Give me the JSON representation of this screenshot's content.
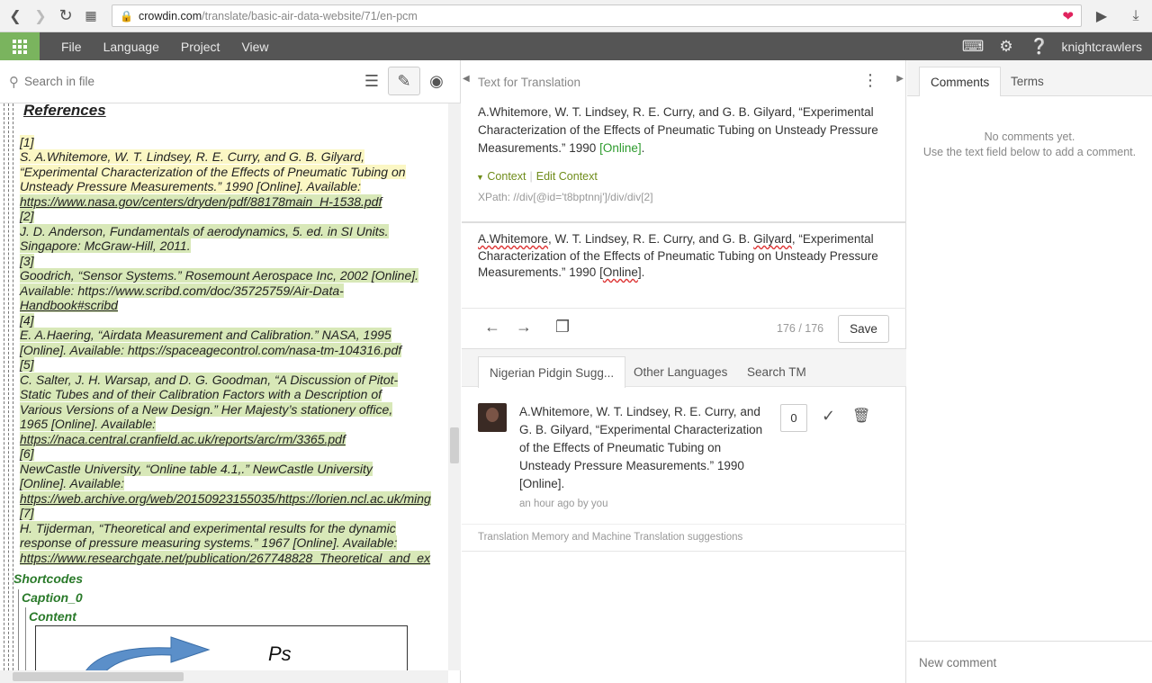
{
  "browser": {
    "url_host": "crowdin.com",
    "url_path": "/translate/basic-air-data-website/71/en-pcm"
  },
  "appbar": {
    "menu": [
      "File",
      "Language",
      "Project",
      "View"
    ],
    "user": "knightcrawlers"
  },
  "left": {
    "search_placeholder": "Search in file",
    "refs_title": "References",
    "refs": [
      {
        "text": "[1]",
        "hl": "y"
      },
      {
        "text": "S. A.Whitemore, W. T. Lindsey, R. E. Curry, and G. B. Gilyard,",
        "hl": "y"
      },
      {
        "text": "“Experimental Characterization of the Effects of Pneumatic Tubing on",
        "hl": "y"
      },
      {
        "text": "Unsteady Pressure Measurements.” 1990 [Online]. Available:",
        "hl": "y"
      },
      {
        "text": "https://www.nasa.gov/centers/dryden/pdf/88178main_H-1538.pdf",
        "hl": "g",
        "link": true
      },
      {
        "text": "[2]",
        "hl": "g"
      },
      {
        "text": "J. D. Anderson, Fundamentals of aerodynamics, 5. ed. in SI Units.",
        "hl": "g"
      },
      {
        "text": "Singapore: McGraw-Hill, 2011.",
        "hl": "g"
      },
      {
        "text": "[3]",
        "hl": "g"
      },
      {
        "text": "Goodrich, “Sensor Systems.” Rosemount Aerospace Inc, 2002 [Online].",
        "hl": "g"
      },
      {
        "text": "Available: https://www.scribd.com/doc/35725759/Air-Data-",
        "hl": "g"
      },
      {
        "text": "Handbook#scribd",
        "hl": "g",
        "link": true
      },
      {
        "text": "[4]",
        "hl": "g"
      },
      {
        "text": "E. A.Haering, “Airdata Measurement and Calibration.” NASA, 1995",
        "hl": "g"
      },
      {
        "text": "[Online]. Available: https://spaceagecontrol.com/nasa-tm-104316.pdf",
        "hl": "g"
      },
      {
        "text": "[5]",
        "hl": "g"
      },
      {
        "text": "C. Salter, J. H. Warsap, and D. G. Goodman, “A Discussion of Pitot-",
        "hl": "g"
      },
      {
        "text": "Static Tubes and of their Calibration Factors with a Description of",
        "hl": "g"
      },
      {
        "text": "Various Versions of a New Design.” Her Majesty’s stationery office,",
        "hl": "g"
      },
      {
        "text": "1965 [Online]. Available:",
        "hl": "g"
      },
      {
        "text": "https://naca.central.cranfield.ac.uk/reports/arc/rm/3365.pdf",
        "hl": "g",
        "link": true
      },
      {
        "text": "[6]",
        "hl": "g"
      },
      {
        "text": "NewCastle University, “Online table 4.1,.” NewCastle University",
        "hl": "g"
      },
      {
        "text": "[Online]. Available:",
        "hl": "g"
      },
      {
        "text": "https://web.archive.org/web/20150923155035/https://lorien.ncl.ac.uk/ming",
        "hl": "g",
        "link": true
      },
      {
        "text": "[7]",
        "hl": "g"
      },
      {
        "text": "H. Tijderman, “Theoretical and experimental results for the dynamic",
        "hl": "g"
      },
      {
        "text": "response of pressure measuring systems.” 1967 [Online]. Available:",
        "hl": "g"
      },
      {
        "text": "https://www.researchgate.net/publication/267748828_Theoretical_and_ex",
        "hl": "g",
        "link": true
      }
    ],
    "shortcodes": "Shortcodes",
    "caption": "Caption_0",
    "content": "Content",
    "img_text": "Ps"
  },
  "middle": {
    "header": "Text for Translation",
    "source_main": "A.Whitemore, W. T. Lindsey, R. E. Curry, and G. B. Gilyard, “Experimental Characterization of the Effects of Pneumatic Tubing on Unsteady Pressure Measurements.” 1990 ",
    "source_tag": "[Online]",
    "source_end": ".",
    "context_label": "Context",
    "edit_context": "Edit Context",
    "xpath": "XPath: //div[@id='t8bptnnj']/div/div[2]",
    "target_a": "A.Whitemore",
    "target_b": ", W. T. Lindsey, R. E. Curry, and G. B. ",
    "target_c": "Gilyard",
    "target_d": ", “Experimental Characterization of the Effects of Pneumatic Tubing on Unsteady Pressure Measurements.” 1990 [",
    "target_e": "Online",
    "target_f": "].",
    "counter": "176 / 176",
    "save": "Save",
    "tabs": [
      "Nigerian Pidgin Sugg...",
      "Other Languages",
      "Search TM"
    ],
    "suggestion": "A.Whitemore, W. T. Lindsey, R. E. Curry, and G. B. Gilyard, “Experimental Characterization of the Effects of Pneumatic Tubing on Unsteady Pressure Measurements.” 1990 [Online].",
    "suggestion_meta": "an hour ago by you",
    "votes": "0",
    "tm_note": "Translation Memory and Machine Translation suggestions"
  },
  "right": {
    "tabs": [
      "Comments",
      "Terms"
    ],
    "no_comments": "No comments yet.",
    "no_comments_hint": "Use the text field below to add a comment.",
    "new_comment_placeholder": "New comment"
  },
  "colors": {
    "accent_green": "#7ab45e",
    "appbar": "#555555",
    "highlight_yellow": "#fbf7c4",
    "highlight_green": "#d8e8b8"
  },
  "icons": [
    "back-arrow-icon",
    "forward-arrow-icon",
    "reload-icon",
    "apps-icon",
    "lock-icon",
    "heart-icon",
    "send-icon",
    "download-icon",
    "grid-icon",
    "keyboard-icon",
    "gear-icon",
    "help-icon",
    "search-icon",
    "list-icon",
    "pencil-icon",
    "eye-icon",
    "kebab-icon",
    "check-icon",
    "trash-icon",
    "copy-icon"
  ]
}
